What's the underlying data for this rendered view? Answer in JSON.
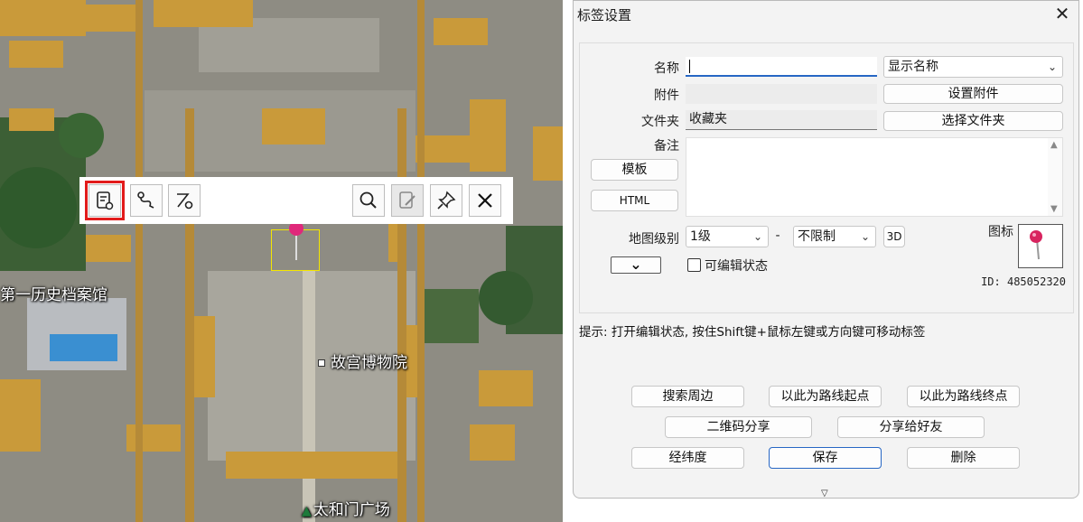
{
  "map": {
    "labels": {
      "archive": "第一历史档案馆",
      "museum": "故宫博物院",
      "plaza": "太和门广场"
    },
    "toolbar": {
      "buttons": [
        {
          "name": "label-settings-icon",
          "highlighted": true
        },
        {
          "name": "route-icon"
        },
        {
          "name": "route-point-icon"
        },
        {
          "name": "search-icon"
        },
        {
          "name": "edit-icon",
          "disabled": true
        },
        {
          "name": "pin-icon"
        },
        {
          "name": "close-icon"
        }
      ]
    },
    "colors": {
      "highlight": "#e21b1b",
      "selection": "#f4e600",
      "pin": "#e0287a"
    }
  },
  "dialog": {
    "title": "标签设置",
    "close_glyph": "✕",
    "form": {
      "name_label": "名称",
      "name_value": "",
      "name_display_select": "显示名称",
      "attachment_label": "附件",
      "attachment_value": "",
      "attachment_button": "设置附件",
      "folder_label": "文件夹",
      "folder_value": "收藏夹",
      "folder_button": "选择文件夹",
      "note_label": "备注",
      "note_value": "",
      "template_button": "模板",
      "html_button": "HTML",
      "map_level_label": "地图级别",
      "level_min": "1级",
      "level_sep": "-",
      "level_max": "不限制",
      "btn_3d": "3D",
      "icon_label": "图标",
      "expand_glyph": "⌄",
      "editable_label": "可编辑状态",
      "editable_checked": false,
      "id_text": "ID: 485052320"
    },
    "hint": "提示: 打开编辑状态, 按住Shift键+鼠标左键或方向键可移动标签",
    "actions": {
      "search_nearby": "搜索周边",
      "route_start": "以此为路线起点",
      "route_end": "以此为路线终点",
      "qr_share": "二维码分享",
      "share_friend": "分享给好友",
      "lat_lng": "经纬度",
      "save": "保存",
      "delete": "删除"
    },
    "colors": {
      "focus_underline": "#2767c4",
      "save_border": "#2767c4"
    }
  }
}
